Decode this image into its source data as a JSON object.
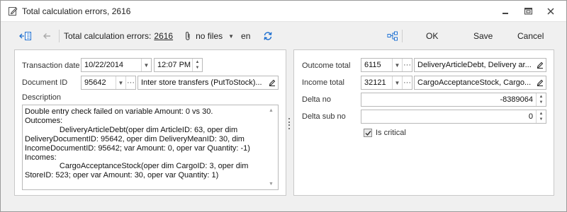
{
  "window": {
    "title": "Total calculation errors, 2616",
    "controls": [
      "restore",
      "maximize",
      "close"
    ]
  },
  "toolbar": {
    "label": "Total calculation errors:",
    "error_count": "2616",
    "files": "no files",
    "language": "en",
    "ok_label": "OK",
    "save_label": "Save",
    "cancel_label": "Cancel"
  },
  "left": {
    "transaction_date_label": "Transaction date",
    "transaction_date": "10/22/2014",
    "transaction_time": "12:07 PM",
    "document_id_label": "Document ID",
    "document_id": "95642",
    "document_name": "Inter store transfers (PutToStock)...",
    "description_label": "Description",
    "description": "Double entry check failed on variable Amount: 0 vs 30.\nOutcomes:\n\t\tDeliveryArticleDebt(oper dim ArticleID: 63, oper dim DeliveryDocumentID: 95642, oper dim DeliveryMeanID: 30, dim IncomeDocumentID: 95642; var Amount: 0, oper var Quantity: -1)\nIncomes:\n\t\tCargoAcceptanceStock(oper dim CargoID: 3, oper dim StoreID: 523; oper var Amount: 30, oper var Quantity: 1)"
  },
  "right": {
    "outcome_total_label": "Outcome total",
    "outcome_total": "6115",
    "outcome_name": "DeliveryArticleDebt, Delivery ar...",
    "income_total_label": "Income total",
    "income_total": "32121",
    "income_name": "CargoAcceptanceStock, Cargo...",
    "delta_no_label": "Delta no",
    "delta_no": "-8389064",
    "delta_sub_no_label": "Delta sub no",
    "delta_sub_no": "0",
    "is_critical_label": "Is critical",
    "is_critical": true
  },
  "icons": {
    "app": "edit-document-icon",
    "toolbar": [
      "panel-toggle-icon",
      "back-icon",
      "attachment-icon",
      "refresh-icon",
      "network-icon"
    ]
  },
  "colors": {
    "accent": "#1e6fd0",
    "border": "#b9b9b9",
    "panel": "#ffffff",
    "background": "#f0f0f0"
  }
}
